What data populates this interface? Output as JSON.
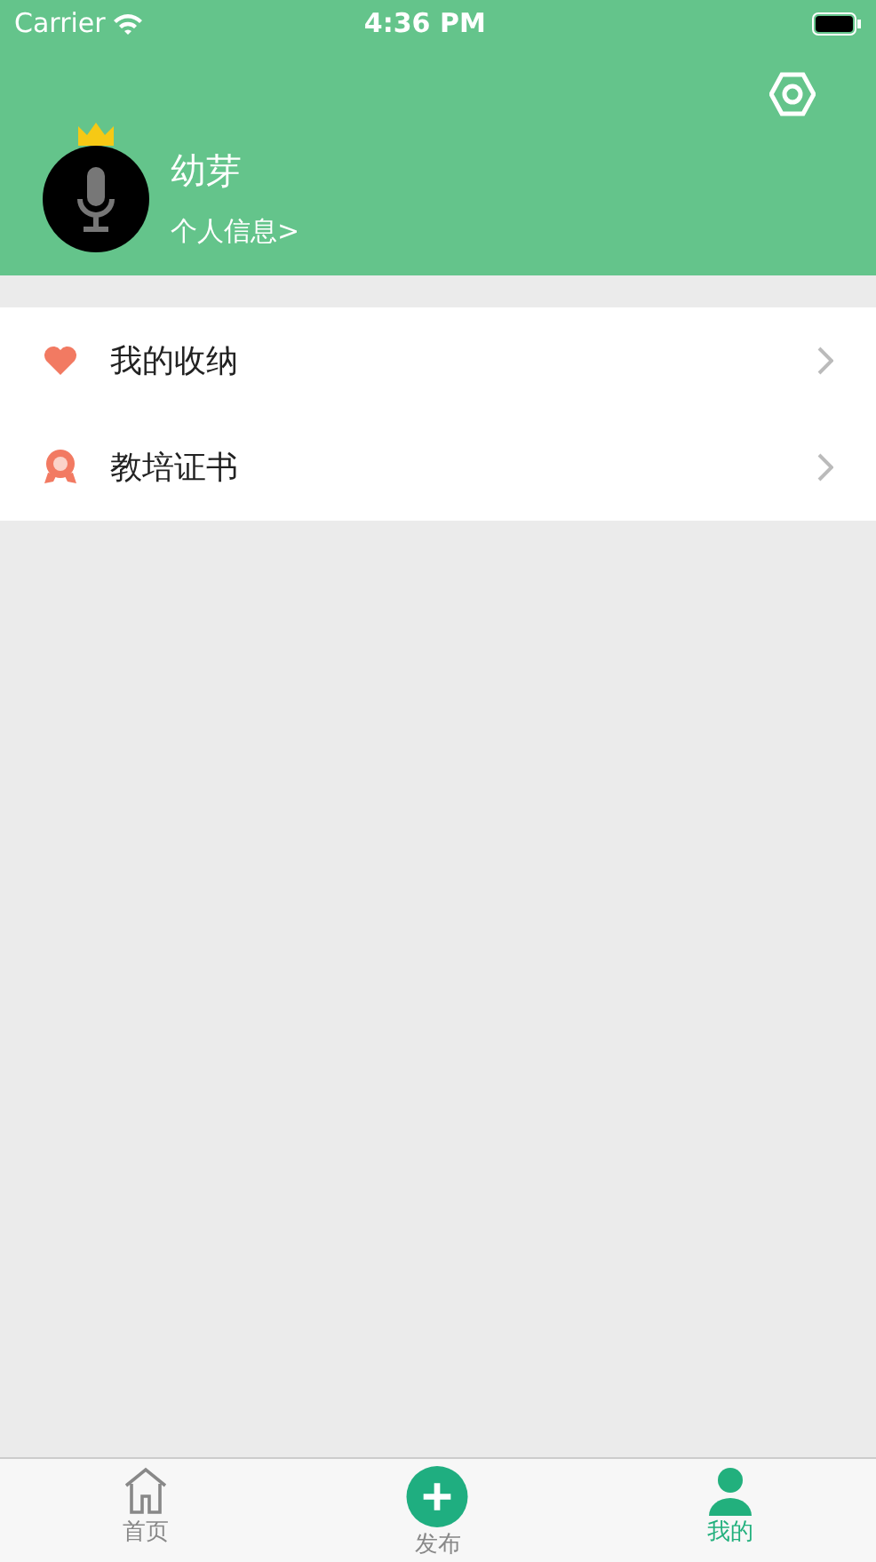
{
  "status_bar": {
    "carrier": "Carrier",
    "time": "4:36 PM"
  },
  "profile": {
    "name": "幼芽",
    "info_link": "个人信息>"
  },
  "menu": [
    {
      "kind": "heart",
      "label": "我的收纳"
    },
    {
      "kind": "badge",
      "label": "教培证书"
    }
  ],
  "tab_bar": [
    {
      "kind": "home",
      "label": "首页",
      "selected": false
    },
    {
      "kind": "publish",
      "label": "发布",
      "selected": false
    },
    {
      "kind": "profile",
      "label": "我的",
      "selected": true
    }
  ]
}
